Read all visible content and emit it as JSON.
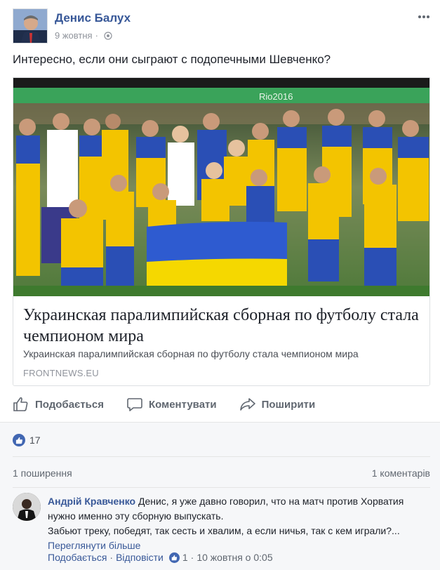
{
  "post": {
    "author": "Денис Балух",
    "date": "9 жовтня",
    "date_separator": "·",
    "text": "Интересно, если они сыграют с подопечными Шевченко?"
  },
  "link_card": {
    "image_icon": "team-photo-image",
    "banner_text": "Rio2016",
    "title": "Украинская паралимпийская сборная по футболу стала чемпионом мира",
    "description": "Украинская паралимпийская сборная по футболу стала чемпионом мира",
    "domain": "FRONTNEWS.EU"
  },
  "actions": {
    "like": "Подобається",
    "comment": "Коментувати",
    "share": "Поширити"
  },
  "stats": {
    "likes": "17",
    "shares": "1 поширення",
    "comments": "1 коментарів"
  },
  "comment": {
    "author": "Андрій Кравченко",
    "text": " Денис, я уже давно говорил, что на матч против Хорватия нужно именно эту сборную выпускать.",
    "text2": "Забьют треку, победят, так сесть и хвалим, а если ничья, так с кем играли?...",
    "see_more": "Переглянути більше",
    "like_label": "Подобається",
    "dot": "·",
    "reply_label": "Відповісти",
    "like_count": "1",
    "time": "10 жовтня о 0:05"
  },
  "colors": {
    "link_blue": "#385898",
    "brand_blue": "#4267b2",
    "ukraine_blue": "#2e5bd0",
    "ukraine_yellow": "#f5d800"
  }
}
